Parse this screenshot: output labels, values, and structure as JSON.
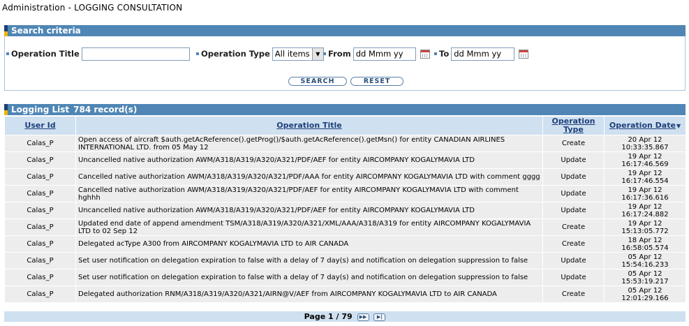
{
  "page": {
    "section": "Administration",
    "separator": "-",
    "title": "LOGGING CONSULTATION"
  },
  "search": {
    "header": "Search criteria",
    "operation_title_label": "Operation Title",
    "operation_title_value": "",
    "operation_type_label": "Operation Type",
    "operation_type_value": "All items",
    "from_label": "From",
    "from_value": "dd Mmm yy",
    "to_label": "To",
    "to_value": "dd Mmm yy",
    "search_button": "SEARCH",
    "reset_button": "RESET"
  },
  "list": {
    "header": "Logging List",
    "record_count": "784 record(s)",
    "columns": {
      "user_id": "User Id",
      "operation_title": "Operation Title",
      "operation_type": "Operation Type",
      "operation_date": "Operation Date"
    },
    "rows": [
      {
        "user": "Calas_P",
        "title": "Open access of aircraft $auth.getAcReference().getProg()/$auth.getAcReference().getMsn() for entity CANADIAN AIRLINES INTERNATIONAL LTD. from 05 May 12",
        "type": "Create",
        "date": "20 Apr 12",
        "time": "10:33:35.867"
      },
      {
        "user": "Calas_P",
        "title": "Uncancelled native authorization AWM/A318/A319/A320/A321/PDF/AEF for entity AIRCOMPANY KOGALYMAVIA LTD",
        "type": "Update",
        "date": "19 Apr 12",
        "time": "16:17:46.569"
      },
      {
        "user": "Calas_P",
        "title": "Cancelled native authorization AWM/A318/A319/A320/A321/PDF/AAA for entity AIRCOMPANY KOGALYMAVIA LTD with comment gggg",
        "type": "Update",
        "date": "19 Apr 12",
        "time": "16:17:46.554"
      },
      {
        "user": "Calas_P",
        "title": "Cancelled native authorization AWM/A318/A319/A320/A321/PDF/AEF for entity AIRCOMPANY KOGALYMAVIA LTD with comment hghhh",
        "type": "Update",
        "date": "19 Apr 12",
        "time": "16:17:36.616"
      },
      {
        "user": "Calas_P",
        "title": "Uncancelled native authorization AWM/A318/A319/A320/A321/PDF/AEF for entity AIRCOMPANY KOGALYMAVIA LTD",
        "type": "Update",
        "date": "19 Apr 12",
        "time": "16:17:24.882"
      },
      {
        "user": "Calas_P",
        "title": "Updated end date of append amendment TSM/A318/A319/A320/A321/XML/AAA/A318/A319 for entity AIRCOMPANY KOGALYMAVIA LTD to 02 Sep 12",
        "type": "Create",
        "date": "19 Apr 12",
        "time": "15:13:05.772"
      },
      {
        "user": "Calas_P",
        "title": "Delegated acType A300 from AIRCOMPANY KOGALYMAVIA LTD to AIR CANADA",
        "type": "Create",
        "date": "18 Apr 12",
        "time": "16:58:05.574"
      },
      {
        "user": "Calas_P",
        "title": "Set user notification on delegation expiration to false with a delay of 7 day(s) and notification on delegation suppression to false",
        "type": "Update",
        "date": "05 Apr 12",
        "time": "15:54:16.233"
      },
      {
        "user": "Calas_P",
        "title": "Set user notification on delegation expiration to false with a delay of 7 day(s) and notification on delegation suppression to false",
        "type": "Update",
        "date": "05 Apr 12",
        "time": "15:53:19.217"
      },
      {
        "user": "Calas_P",
        "title": "Delegated authorization RNM/A318/A319/A320/A321/AIRN@V/AEF from AIRCOMPANY KOGALYMAVIA LTD to AIR CANADA",
        "type": "Create",
        "date": "05 Apr 12",
        "time": "12:01:29.166"
      }
    ]
  },
  "pager": {
    "label": "Page 1 / 79",
    "next_icon": "fast-forward-icon",
    "last_icon": "last-page-icon"
  },
  "colors": {
    "header_bar": "#4f86b5",
    "header_accent": "#f0b400",
    "table_header": "#cfe0f0",
    "row_bg": "#ededed",
    "link": "#1d3f7a"
  }
}
